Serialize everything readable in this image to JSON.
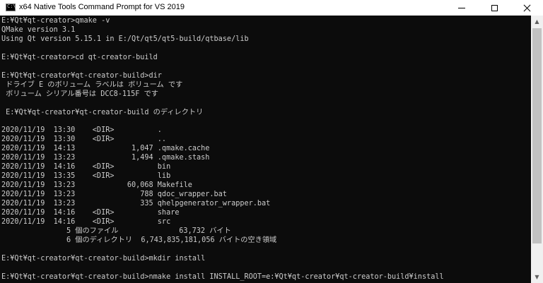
{
  "window": {
    "title": "x64 Native Tools Command Prompt for VS 2019",
    "icon": "console-icon"
  },
  "console": {
    "lines": [
      "E:¥Qt¥qt-creator>qmake -v",
      "QMake version 3.1",
      "Using Qt version 5.15.1 in E:/Qt/qt5/qt5-build/qtbase/lib",
      "",
      "E:¥Qt¥qt-creator>cd qt-creator-build",
      "",
      "E:¥Qt¥qt-creator¥qt-creator-build>dir",
      " ドライブ E のボリューム ラベルは ボリューム です",
      " ボリューム シリアル番号は DCC8-115F です",
      "",
      " E:¥Qt¥qt-creator¥qt-creator-build のディレクトリ",
      "",
      "2020/11/19  13:30    <DIR>          .",
      "2020/11/19  13:30    <DIR>          ..",
      "2020/11/19  14:13             1,047 .qmake.cache",
      "2020/11/19  13:23             1,494 .qmake.stash",
      "2020/11/19  14:16    <DIR>          bin",
      "2020/11/19  13:35    <DIR>          lib",
      "2020/11/19  13:23            60,068 Makefile",
      "2020/11/19  13:23               788 qdoc_wrapper.bat",
      "2020/11/19  13:23               335 qhelpgenerator_wrapper.bat",
      "2020/11/19  14:16    <DIR>          share",
      "2020/11/19  14:16    <DIR>          src",
      "               5 個のファイル              63,732 バイト",
      "               6 個のディレクトリ  6,743,835,181,056 バイトの空き領域",
      "",
      "E:¥Qt¥qt-creator¥qt-creator-build>mkdir install",
      "",
      "E:¥Qt¥qt-creator¥qt-creator-build>nmake install INSTALL_ROOT=e:¥Qt¥qt-creator¥qt-creator-build¥install"
    ]
  }
}
